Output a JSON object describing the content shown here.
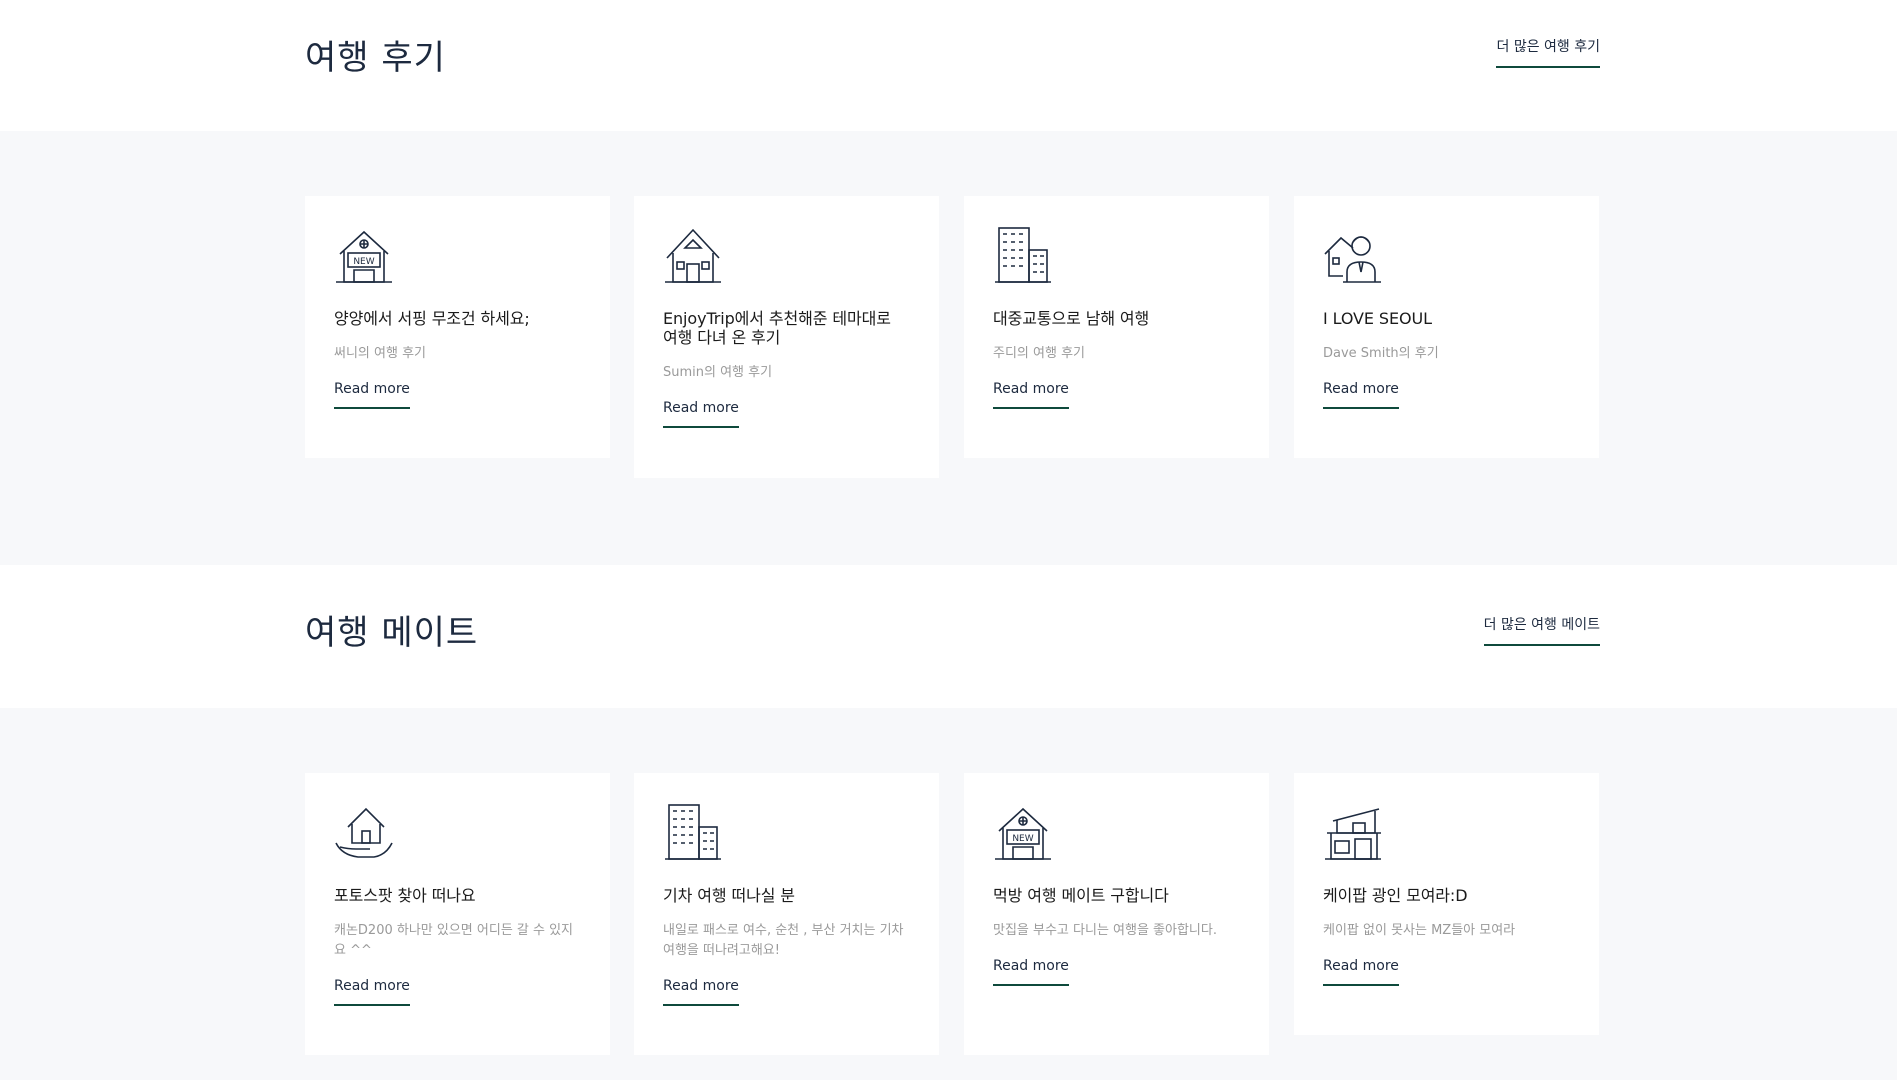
{
  "reviews": {
    "title": "여행 후기",
    "more_label": "더 많은 여행 후기",
    "cards": [
      {
        "icon": "new-house-icon",
        "title": "양양에서 서핑 무조건 하세요;",
        "subtitle": "써니의 여행 후기",
        "link": "Read more"
      },
      {
        "icon": "house-icon",
        "title": "EnjoyTrip에서 추천해준 테마대로 여행 다녀 온 후기",
        "subtitle": "Sumin의 여행 후기",
        "link": "Read more"
      },
      {
        "icon": "building-icon",
        "title": "대중교통으로 남해 여행",
        "subtitle": "주디의 여행 후기",
        "link": "Read more"
      },
      {
        "icon": "agent-house-icon",
        "title": "I LOVE SEOUL",
        "subtitle": "Dave Smith의 후기",
        "link": "Read more"
      }
    ]
  },
  "mates": {
    "title": "여행 메이트",
    "more_label": "더 많은 여행 메이트",
    "cards": [
      {
        "icon": "hand-house-icon",
        "title": "포토스팟 찾아 떠나요",
        "subtitle": "캐논D200 하나만 있으면 어디든 갈 수 있지요 ^^",
        "link": "Read more"
      },
      {
        "icon": "building-icon",
        "title": "기차 여행 떠나실 분",
        "subtitle": "내일로 패스로 여수, 순천 , 부산 거치는 기차 여행을 떠나려고해요!",
        "link": "Read more"
      },
      {
        "icon": "new-house-icon",
        "title": "먹방 여행 메이트 구합니다",
        "subtitle": "맛집을 부수고 다니는 여행을 좋아합니다.",
        "link": "Read more"
      },
      {
        "icon": "modern-house-icon",
        "title": "케이팝 광인 모여라:D",
        "subtitle": "케이팝 없이 못사는 MZ들아 모여라",
        "link": "Read more"
      }
    ]
  }
}
